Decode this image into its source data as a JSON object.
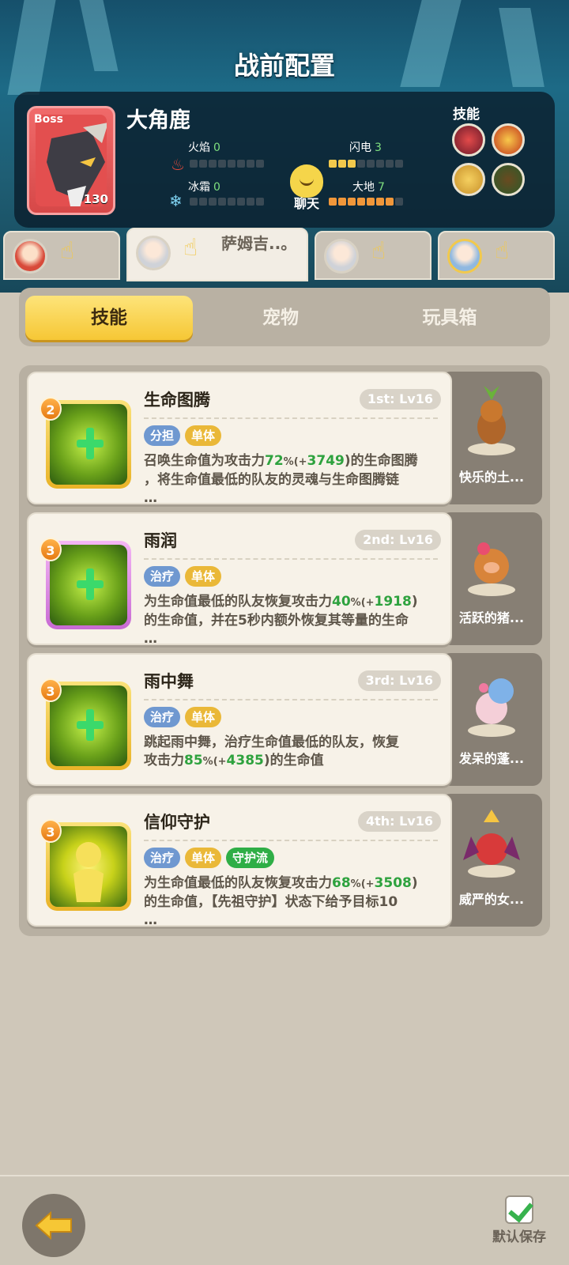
{
  "header": {
    "title": "战前配置"
  },
  "boss": {
    "tag": "Boss",
    "name": "大角鹿",
    "level": "130",
    "elements": [
      {
        "name": "火焰",
        "value": "0",
        "filled": 0
      },
      {
        "name": "闪电",
        "value": "3",
        "filled": 3
      },
      {
        "name": "冰霜",
        "value": "0",
        "filled": 0
      },
      {
        "name": "大地",
        "value": "7",
        "filled": 7
      }
    ],
    "skills_label": "技能"
  },
  "chat": {
    "label": "聊天"
  },
  "heroes": [
    {
      "name": ""
    },
    {
      "name": "萨姆吉..。"
    },
    {
      "name": ""
    },
    {
      "name": ""
    }
  ],
  "main_tabs": [
    {
      "label": "技能",
      "active": true
    },
    {
      "label": "宠物",
      "active": false
    },
    {
      "label": "玩具箱",
      "active": false
    }
  ],
  "skills": [
    {
      "cost": "2",
      "title": "生命图腾",
      "rank": "1st: Lv16",
      "tags": [
        "分担",
        "单体"
      ],
      "desc_1": "召唤生命值为攻击力",
      "desc_pct": "72",
      "desc_pct_sign": "%(+",
      "desc_bonus": "3749",
      "desc_2": ")的生命图腾",
      "desc_3": "，将生命值最低的队友的灵魂与生命图腾链",
      "desc_4": "…",
      "pet": "快乐的土..."
    },
    {
      "cost": "3",
      "title": "雨润",
      "rank": "2nd: Lv16",
      "tags": [
        "治疗",
        "单体"
      ],
      "desc_1": "为生命值最低的队友恢复攻击力",
      "desc_pct": "40",
      "desc_pct_sign": "%(+",
      "desc_bonus": "1918",
      "desc_2": ")",
      "desc_3": "的生命值，并在5秒内额外恢复其等量的生命",
      "desc_4": "…",
      "pet": "活跃的猪..."
    },
    {
      "cost": "3",
      "title": "雨中舞",
      "rank": "3rd: Lv16",
      "tags": [
        "治疗",
        "单体"
      ],
      "desc_1": "跳起雨中舞，治疗生命值最低的队友，恢复",
      "desc_2a": "攻击力",
      "desc_pct": "85",
      "desc_pct_sign": "%(+",
      "desc_bonus": "4385",
      "desc_2": ")的生命值",
      "pet": "发呆的蓬..."
    },
    {
      "cost": "3",
      "title": "信仰守护",
      "rank": "4th: Lv16",
      "tags": [
        "治疗",
        "单体",
        "守护流"
      ],
      "desc_1": "为生命值最低的队友恢复攻击力",
      "desc_pct": "68",
      "desc_pct_sign": "%(+",
      "desc_bonus": "3508",
      "desc_2": ")",
      "desc_3": "的生命值，【先祖守护】状态下给予目标10",
      "desc_4": "…",
      "pet": "威严的女..."
    }
  ],
  "footer": {
    "save_label": "默认保存"
  }
}
